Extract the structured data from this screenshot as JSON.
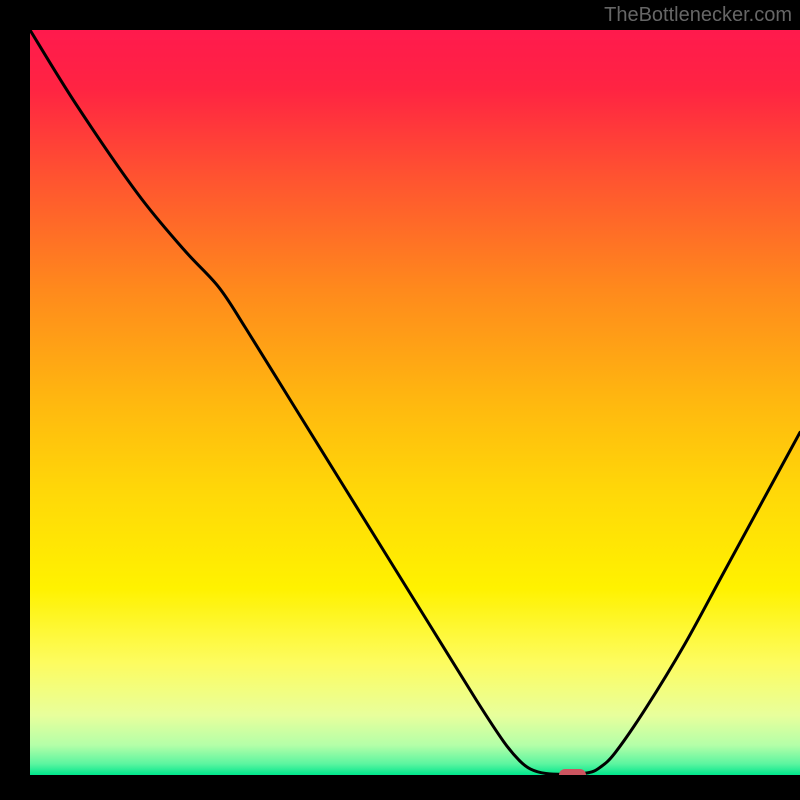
{
  "watermark": "TheBottlenecker.com",
  "chart_data": {
    "type": "line",
    "title": "",
    "xlabel": "",
    "ylabel": "",
    "xlim": [
      0,
      100
    ],
    "ylim": [
      0,
      100
    ],
    "gradient_stops": [
      {
        "offset": 0,
        "color": "#ff1a4d"
      },
      {
        "offset": 8,
        "color": "#ff2442"
      },
      {
        "offset": 20,
        "color": "#ff5430"
      },
      {
        "offset": 35,
        "color": "#ff8a1c"
      },
      {
        "offset": 50,
        "color": "#ffb80f"
      },
      {
        "offset": 62,
        "color": "#ffd808"
      },
      {
        "offset": 75,
        "color": "#fff200"
      },
      {
        "offset": 85,
        "color": "#fdfc60"
      },
      {
        "offset": 92,
        "color": "#e8ff9c"
      },
      {
        "offset": 96,
        "color": "#b4ffa8"
      },
      {
        "offset": 98.5,
        "color": "#5cf5a0"
      },
      {
        "offset": 100,
        "color": "#00e68c"
      }
    ],
    "series": [
      {
        "name": "bottleneck-curve",
        "points": [
          {
            "x": 0.0,
            "y": 100.0
          },
          {
            "x": 6.0,
            "y": 90.0
          },
          {
            "x": 14.0,
            "y": 78.0
          },
          {
            "x": 20.0,
            "y": 70.5
          },
          {
            "x": 24.5,
            "y": 65.5
          },
          {
            "x": 28.0,
            "y": 60.0
          },
          {
            "x": 34.0,
            "y": 50.0
          },
          {
            "x": 40.0,
            "y": 40.0
          },
          {
            "x": 46.0,
            "y": 30.0
          },
          {
            "x": 52.0,
            "y": 20.0
          },
          {
            "x": 58.0,
            "y": 10.0
          },
          {
            "x": 61.5,
            "y": 4.5
          },
          {
            "x": 63.5,
            "y": 2.0
          },
          {
            "x": 65.0,
            "y": 0.8
          },
          {
            "x": 67.0,
            "y": 0.2
          },
          {
            "x": 70.0,
            "y": 0.1
          },
          {
            "x": 72.5,
            "y": 0.3
          },
          {
            "x": 74.0,
            "y": 1.0
          },
          {
            "x": 76.0,
            "y": 3.0
          },
          {
            "x": 80.0,
            "y": 9.0
          },
          {
            "x": 85.0,
            "y": 17.5
          },
          {
            "x": 90.0,
            "y": 27.0
          },
          {
            "x": 95.0,
            "y": 36.5
          },
          {
            "x": 100.0,
            "y": 46.0
          }
        ]
      }
    ],
    "marker": {
      "x": 70.5,
      "y": 0.0,
      "w": 3.5,
      "h": 1.7
    }
  }
}
